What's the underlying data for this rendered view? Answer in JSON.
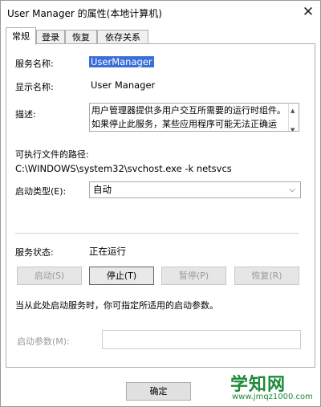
{
  "window": {
    "title": "User Manager 的属性(本地计算机)",
    "close_glyph": "✕"
  },
  "tabs": [
    {
      "label": "常规",
      "active": true
    },
    {
      "label": "登录",
      "active": false
    },
    {
      "label": "恢复",
      "active": false
    },
    {
      "label": "依存关系",
      "active": false
    }
  ],
  "general": {
    "service_name_label": "服务名称:",
    "service_name": "UserManager",
    "display_name_label": "显示名称:",
    "display_name": "User Manager",
    "description_label": "描述:",
    "description": "用户管理器提供多用户交互所需要的运行时组件。如果停止此服务，某些应用程序可能无法正确运行。",
    "path_label": "可执行文件的路径:",
    "path": "C:\\WINDOWS\\system32\\svchost.exe -k netsvcs",
    "startup_type_label": "启动类型(E):",
    "startup_type": "自动",
    "status_label": "服务状态:",
    "status_value": "正在运行",
    "buttons": {
      "start": "启动(S)",
      "stop": "停止(T)",
      "pause": "暂停(P)",
      "resume": "恢复(R)"
    },
    "hint": "当从此处启动服务时，你可指定所适用的启动参数。",
    "params_label": "启动参数(M):",
    "params_value": ""
  },
  "footer": {
    "ok": "确定"
  },
  "watermark": {
    "logo": "学知网",
    "url": "www.jmqz1000.com"
  },
  "colors": {
    "selection": "#3b6fd8",
    "watermark": "#1f8a3a"
  }
}
